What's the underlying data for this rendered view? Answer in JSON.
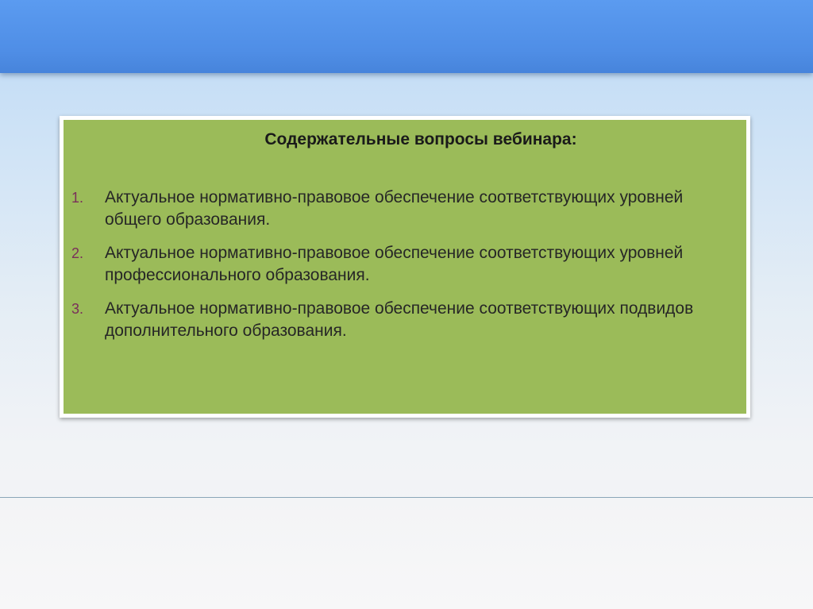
{
  "slide": {
    "title": "Содержательные вопросы вебинара:",
    "topics": [
      {
        "number": "1.",
        "text": "Актуальное нормативно-правовое обеспечение соответствующих уровней общего образования."
      },
      {
        "number": "2.",
        "text": "Актуальное нормативно-правовое обеспечение соответствующих уровней профессионального образования."
      },
      {
        "number": "3.",
        "text": "Актуальное нормативно-правовое обеспечение соответствующих подвидов дополнительного образования."
      }
    ]
  },
  "colors": {
    "top_band": "#4f8ee6",
    "content_box": "#9bbb59",
    "content_border": "#ffffff",
    "list_number": "#7a2f5a"
  }
}
